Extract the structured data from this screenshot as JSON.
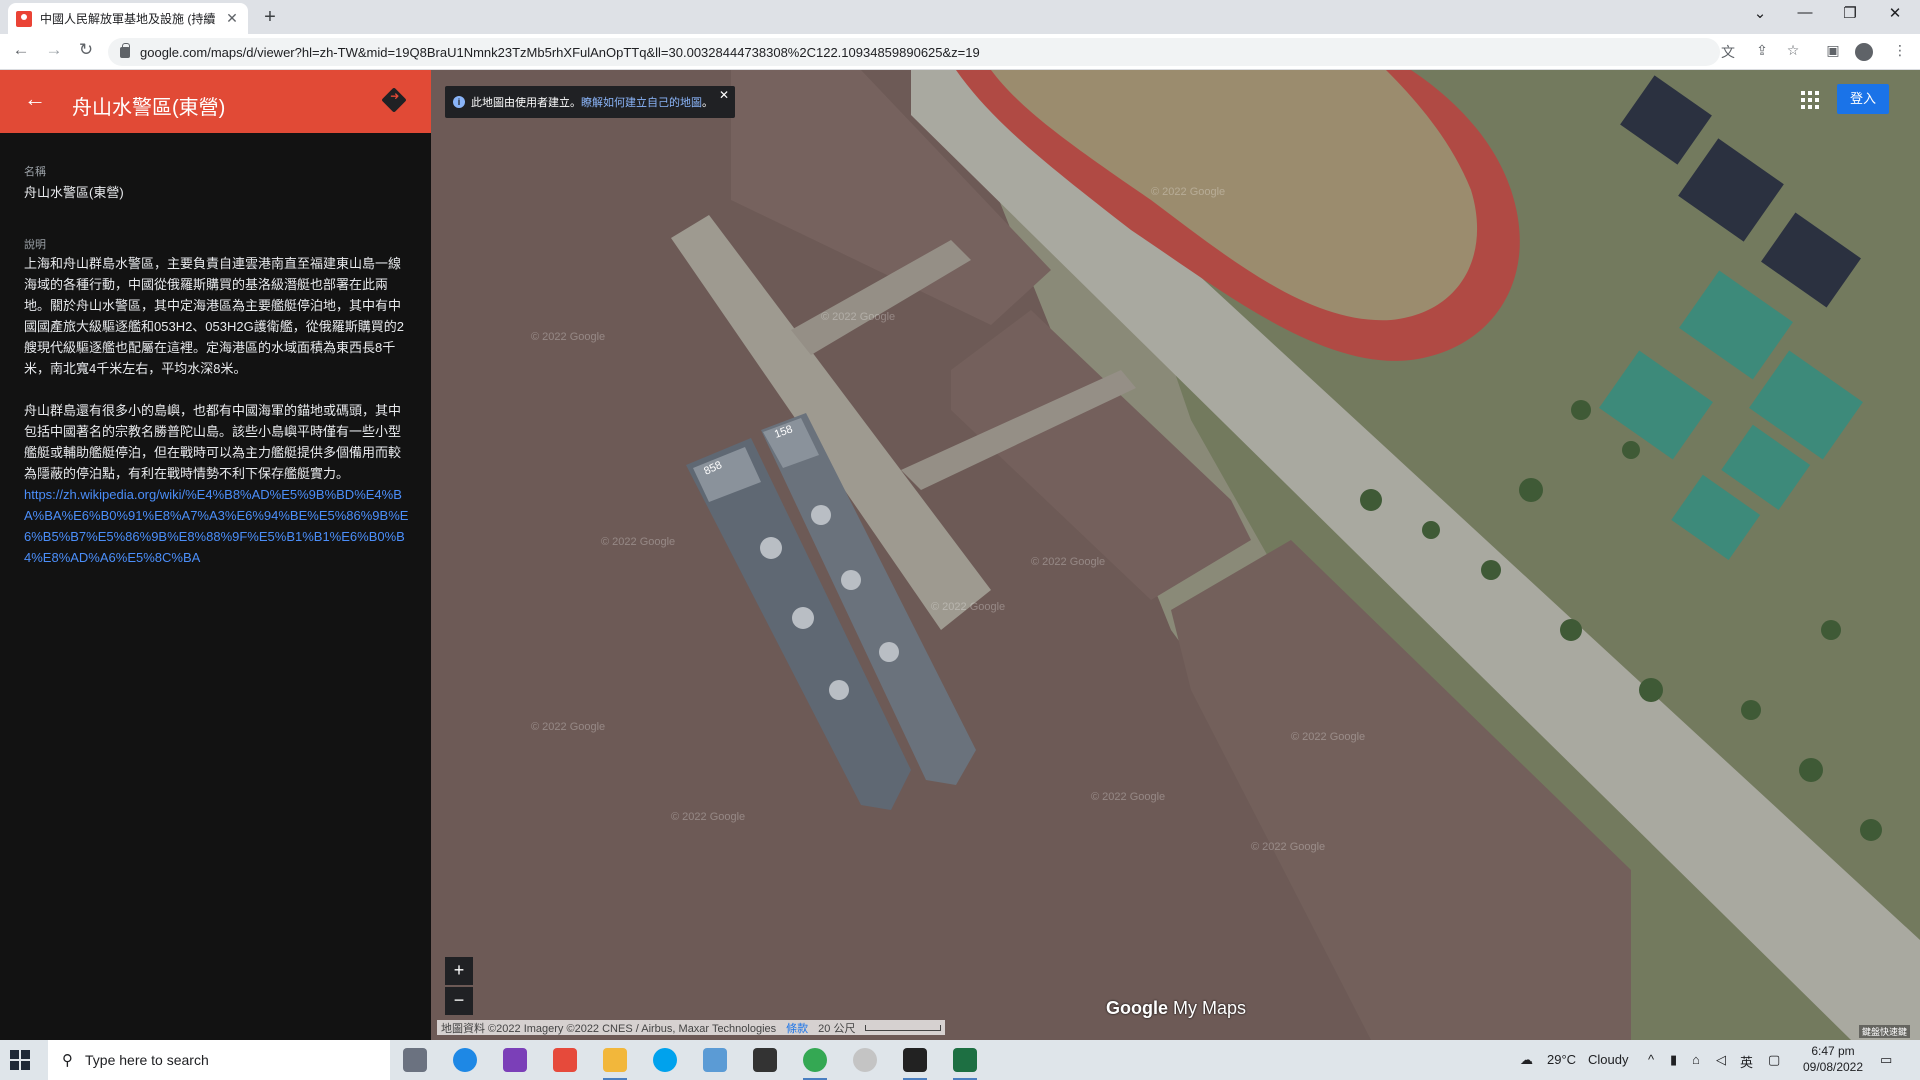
{
  "browser": {
    "tab_title": "中國人民解放軍基地及設施 (持續",
    "tab_close": "✕",
    "new_tab": "+",
    "url": "google.com/maps/d/viewer?hl=zh-TW&mid=19Q8BraU1Nmnk23TzMb5rhXFulAnOpTTq&ll=30.00328444738308%2C122.10934859890625&z=19",
    "window_buttons": {
      "dropdown": "⌄",
      "minimize": "—",
      "restore": "❐",
      "close": "✕"
    },
    "nav": {
      "back": "←",
      "forward": "→",
      "reload": "↻"
    },
    "icons": [
      "translate-icon",
      "share-icon",
      "star-icon",
      "extension-icon",
      "profile-icon",
      "menu-icon"
    ]
  },
  "panel": {
    "title": "舟山水警區(東營)",
    "back_glyph": "←",
    "name_label": "名稱",
    "name_value": "舟山水警區(東營)",
    "desc_label": "說明",
    "paragraph1": "上海和舟山群島水警區，主要負責自連雲港南直至福建東山島一線海域的各種行動，中國從俄羅斯購買的基洛級潛艇也部署在此兩地。關於舟山水警區，其中定海港區為主要艦艇停泊地，其中有中國國產旅大級驅逐艦和053H2、053H2G護衛艦，從俄羅斯購買的2艘現代級驅逐艦也配屬在這裡。定海港區的水域面積為東西長8千米，南北寬4千米左右，平均水深8米。",
    "paragraph2": "舟山群島還有很多小的島嶼，也都有中國海軍的錨地或碼頭，其中包括中國著名的宗教名勝普陀山島。該些小島嶼平時僅有一些小型艦艇或輔助艦艇停泊，但在戰時可以為主力艦艇提供多個備用而較為隱蔽的停泊點，有利在戰時情勢不利下保存艦艇實力。",
    "link": "https://zh.wikipedia.org/wiki/%E4%B8%AD%E5%9B%BD%E4%BA%BA%E6%B0%91%E8%A7%A3%E6%94%BE%E5%86%9B%E6%B5%B7%E5%86%9B%E8%88%9F%E5%B1%B1%E6%B0%B4%E8%AD%A6%E5%8C%BA"
  },
  "map": {
    "notice_text": "此地圖由使用者建立。",
    "notice_link": "瞭解如何建立自己的地圖",
    "notice_end": "。",
    "notice_info": "i",
    "notice_close": "✕",
    "signin_label": "登入",
    "zoom_in": "+",
    "zoom_out": "−",
    "attribution": "地圖資料 ©2022 Imagery ©2022 CNES / Airbus, Maxar Technologies",
    "terms": "條款",
    "scale": "20 公尺",
    "logo_google": "Google",
    "logo_mymaps": "My Maps",
    "keyboard_shortcuts": "鍵盤快速鍵",
    "ship_numbers": [
      "858",
      "158"
    ],
    "watermark": "© 2022 Google"
  },
  "taskbar": {
    "search_placeholder": "Type here to search",
    "search_glyph": "⚲",
    "weather_temp": "29°C",
    "weather_text": "Cloudy",
    "ime": "英",
    "time": "6:47 pm",
    "date": "09/08/2022",
    "tray_up": "^"
  },
  "colors": {
    "panel_header": "#e14a36",
    "link": "#4b8ef9",
    "signin": "#1a73e8",
    "water": "#6d5a56",
    "track": "#c9433d"
  }
}
